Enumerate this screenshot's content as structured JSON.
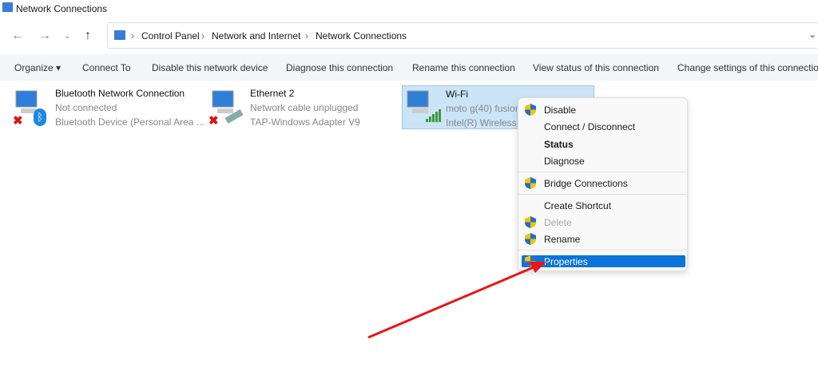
{
  "window": {
    "title": "Network Connections"
  },
  "breadcrumb": [
    "Control Panel",
    "Network and Internet",
    "Network Connections"
  ],
  "toolbar": {
    "organize": "Organize",
    "connect_to": "Connect To",
    "disable": "Disable this network device",
    "diagnose": "Diagnose this connection",
    "rename": "Rename this connection",
    "view_status": "View status of this connection",
    "change_settings": "Change settings of this connection"
  },
  "connections": [
    {
      "name": "Bluetooth Network Connection",
      "status": "Not connected",
      "device": "Bluetooth Device (Personal Area ..."
    },
    {
      "name": "Ethernet 2",
      "status": "Network cable unplugged",
      "device": "TAP-Windows Adapter V9"
    },
    {
      "name": "Wi-Fi",
      "status": "moto g(40) fusion",
      "device": "Intel(R) Wireless-A"
    }
  ],
  "context_menu": {
    "disable": "Disable",
    "connect": "Connect / Disconnect",
    "status": "Status",
    "diagnose": "Diagnose",
    "bridge": "Bridge Connections",
    "shortcut": "Create Shortcut",
    "delete": "Delete",
    "rename": "Rename",
    "properties": "Properties"
  },
  "colors": {
    "accent": "#0a74d8",
    "arrow": "#e8161b"
  }
}
